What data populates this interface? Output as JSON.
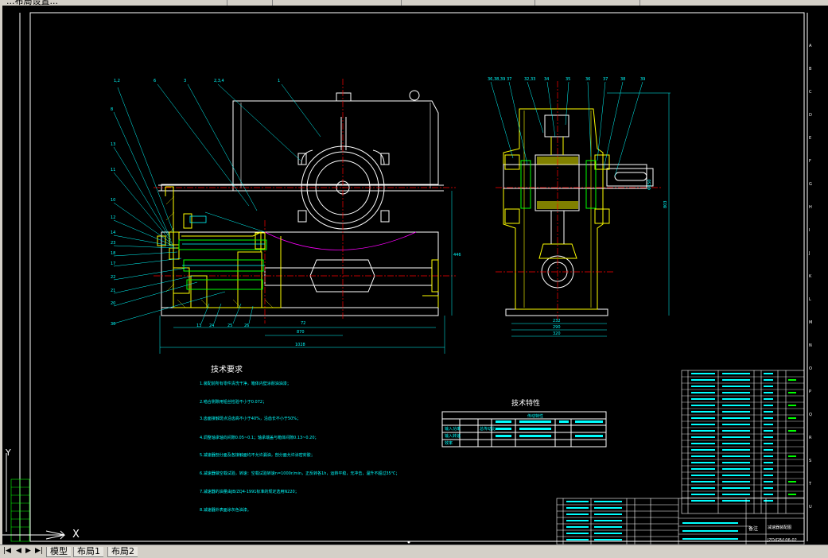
{
  "window": {
    "toolbar_fragment_1": "...布局设置...",
    "toolbar_fragment_2": "",
    "toolbar_fragment_3": ""
  },
  "drawing": {
    "tech_requirements_title": "技术要求",
    "tech_requirements": [
      "1.装配前所有零件清洗干净，箱体内壁涂耐油油漆；",
      "2.啮合侧隙用铅丝检验不小于0.072；",
      "3.齿面接触斑点沿齿高不小于40%，沿齿长不小于50%；",
      "4.调整轴承轴向间隙0.05~0.1；轴承端盖与箱体间隙0.13~0.20；",
      "5.减速器剖分面及各接触面均不允许漏油，剖分面允许涂密封胶；",
      "6.减速器做空载试验，转速：空载试验转速n=1000r/min，正反转各1h，运转平稳，无冲击，温升不超过35℃；",
      "7.减速器的油量由JB/ZQ4-1991标准的规定选用N220；",
      "8.减速器外表面涂灰色油漆。"
    ],
    "tech_specs_title": "技术特性",
    "tech_specs_header": "传动特性",
    "tech_specs_rows": [
      "输入功率",
      "输入转速",
      "效率",
      "总传动比"
    ],
    "dimensions": [
      "1028",
      "870",
      "72",
      "446",
      "232",
      "290",
      "320",
      "Φ150",
      "803"
    ],
    "title_block_code": "JZQ/GB/L06-02",
    "title_block_label": "减速器装配图",
    "parts_header": "备注",
    "border_letters": [
      "A",
      "B",
      "C",
      "D",
      "E",
      "F",
      "G",
      "H",
      "I",
      "J",
      "K",
      "L",
      "M",
      "N",
      "O"
    ],
    "ucs_axis_y": "Y",
    "ucs_axis_x": "X"
  },
  "tabs": {
    "model": "模型",
    "layout1": "布局1",
    "layout2": "布局2"
  },
  "colors": {
    "background": "#000000",
    "outline": "#ffffff",
    "centerline": "#ff0000",
    "section": "#ffff00",
    "annotation": "#00ffff",
    "border": "#00ff00",
    "dimension": "#00ffff"
  }
}
